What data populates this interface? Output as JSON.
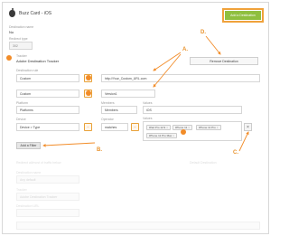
{
  "app": {
    "title": "Buzz Card - iOS"
  },
  "header": {
    "add_destination_label": "Add a Destination"
  },
  "fields": {
    "destination_label": "Destination name",
    "destination_value": "No",
    "redirect_label": "Redirect type",
    "redirect_value": "302",
    "tracker_label": "Tracker",
    "tracker_value": "Adobe Destination Tracker",
    "rule_label": "Destination rule",
    "rule_field_value": "Custom",
    "rule_url_value": "http://Your_Custom_URL.com",
    "second_field_value": "Custom",
    "second_value": "Version1",
    "row3_label_a": "Platform",
    "row3_value_a": "Platforms",
    "row3_label_b": "Members",
    "row3_value_b": "Members",
    "row3_label_c": "Values",
    "row3_value_c": "iOS",
    "device_label": "Device",
    "device_value": "Device > Type",
    "operator_label": "Operator",
    "operator_value": "matches",
    "values_label": "Values",
    "tags": [
      "iPad Pro 12.9",
      "iPhone 11",
      "iPhone 11 Pro",
      "iPhone 11 Pro Max"
    ]
  },
  "buttons": {
    "remove_destination": "Remove Destination",
    "add_filter": "Add a Filter",
    "clear": "×",
    "minus": "−"
  },
  "lower_section": {
    "label_1": "Redirect all/most of traffic below",
    "label_2": "Destination name",
    "label_3": "Tracker",
    "label_4": "Destination URL",
    "value_1": "Any default",
    "value_2": "Adobe Destination Tracker",
    "right_label": "Default Destination"
  },
  "callouts": {
    "a": "A.",
    "b": "B.",
    "c": "C.",
    "d": "D."
  },
  "colors": {
    "accent_orange": "#f28c28",
    "button_green": "#8fbf3f"
  }
}
